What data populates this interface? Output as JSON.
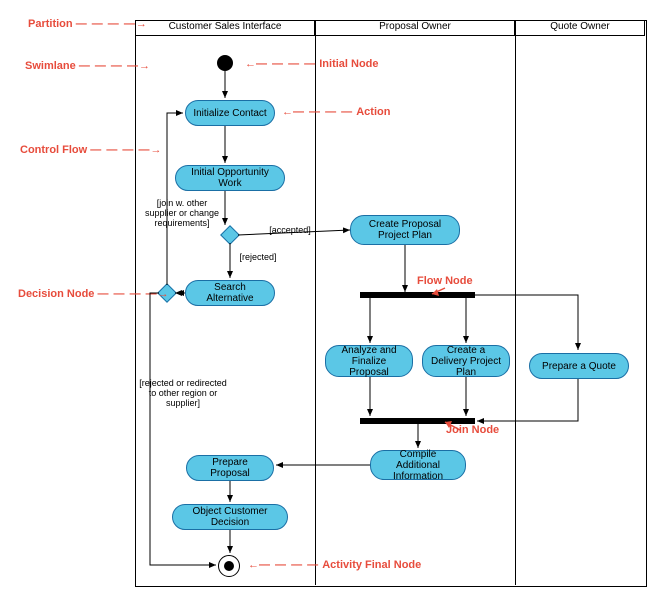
{
  "lanes": {
    "l1": "Customer Sales Interface",
    "l2": "Proposal Owner",
    "l3": "Quote Owner"
  },
  "actions": {
    "a1": "Initialize Contact",
    "a2": "Initial Opportunity Work",
    "a3": "Search Alternative",
    "a4": "Create Proposal Project Plan",
    "a5": "Analyze and Finalize Proposal",
    "a6": "Create a Delivery Project Plan",
    "a7": "Prepare a Quote",
    "a8": "Compile Additional Information",
    "a9": "Prepare Proposal",
    "a10": "Object Customer Decision"
  },
  "guards": {
    "g1": "[join w. other supplier or change requirements]",
    "g2": "[accepted]",
    "g3": "[rejected]",
    "g4": "[rejected or redirected to other region or supplier]"
  },
  "callouts": {
    "c1": "Partition",
    "c2": "Swimlane",
    "c3": "Initial Node",
    "c4": "Action",
    "c5": "Control Flow",
    "c6": "Decision Node",
    "c7": "Flow Node",
    "c8": "Join Node",
    "c9": "Activity Final Node"
  },
  "dash": "— — — —",
  "arrow_r": "→",
  "arrow_l": "←"
}
